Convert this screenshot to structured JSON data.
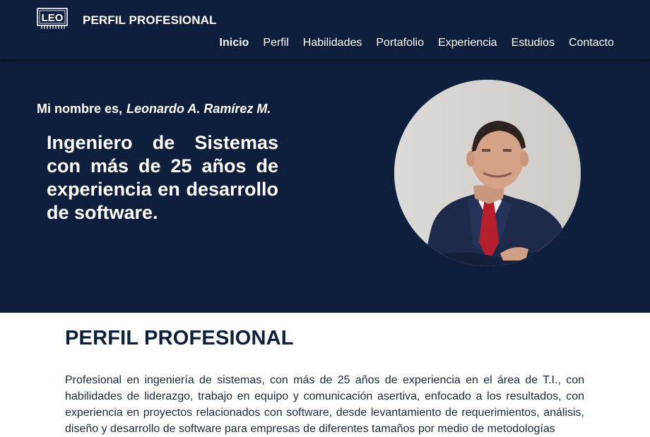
{
  "navbar": {
    "brand": "PERFIL PROFESIONAL",
    "logo_icon": "circuit-board-icon",
    "links": [
      {
        "label": "Inicio",
        "active": true
      },
      {
        "label": "Perfil"
      },
      {
        "label": "Habilidades"
      },
      {
        "label": "Portafolio"
      },
      {
        "label": "Experiencia"
      },
      {
        "label": "Estudios"
      },
      {
        "label": "Contacto"
      }
    ]
  },
  "hero": {
    "intro": "Mi nombre es,",
    "name": "Leonardo A. Ramírez M.",
    "headline": "Ingeniero de Sistemas con más de 25 años de experiencia en desarrollo de software."
  },
  "profile": {
    "title": "PERFIL PROFESIONAL",
    "body": "Profesional en ingeniería de sistemas, con más de 25 años de experiencia en el área de T.I., con habilidades de liderazgo, trabajo en equipo y comunicación asertiva, enfocado a los resultados, con experiencia en proyectos relacionados con software, desde levantamiento de requerimientos, análisis, diseño y desarrollo de software para empresas de diferentes tamaños por medio de metodologías"
  },
  "colors": {
    "navy": "#0d1f3c",
    "white": "#ffffff",
    "tie_red": "#b5202a"
  }
}
